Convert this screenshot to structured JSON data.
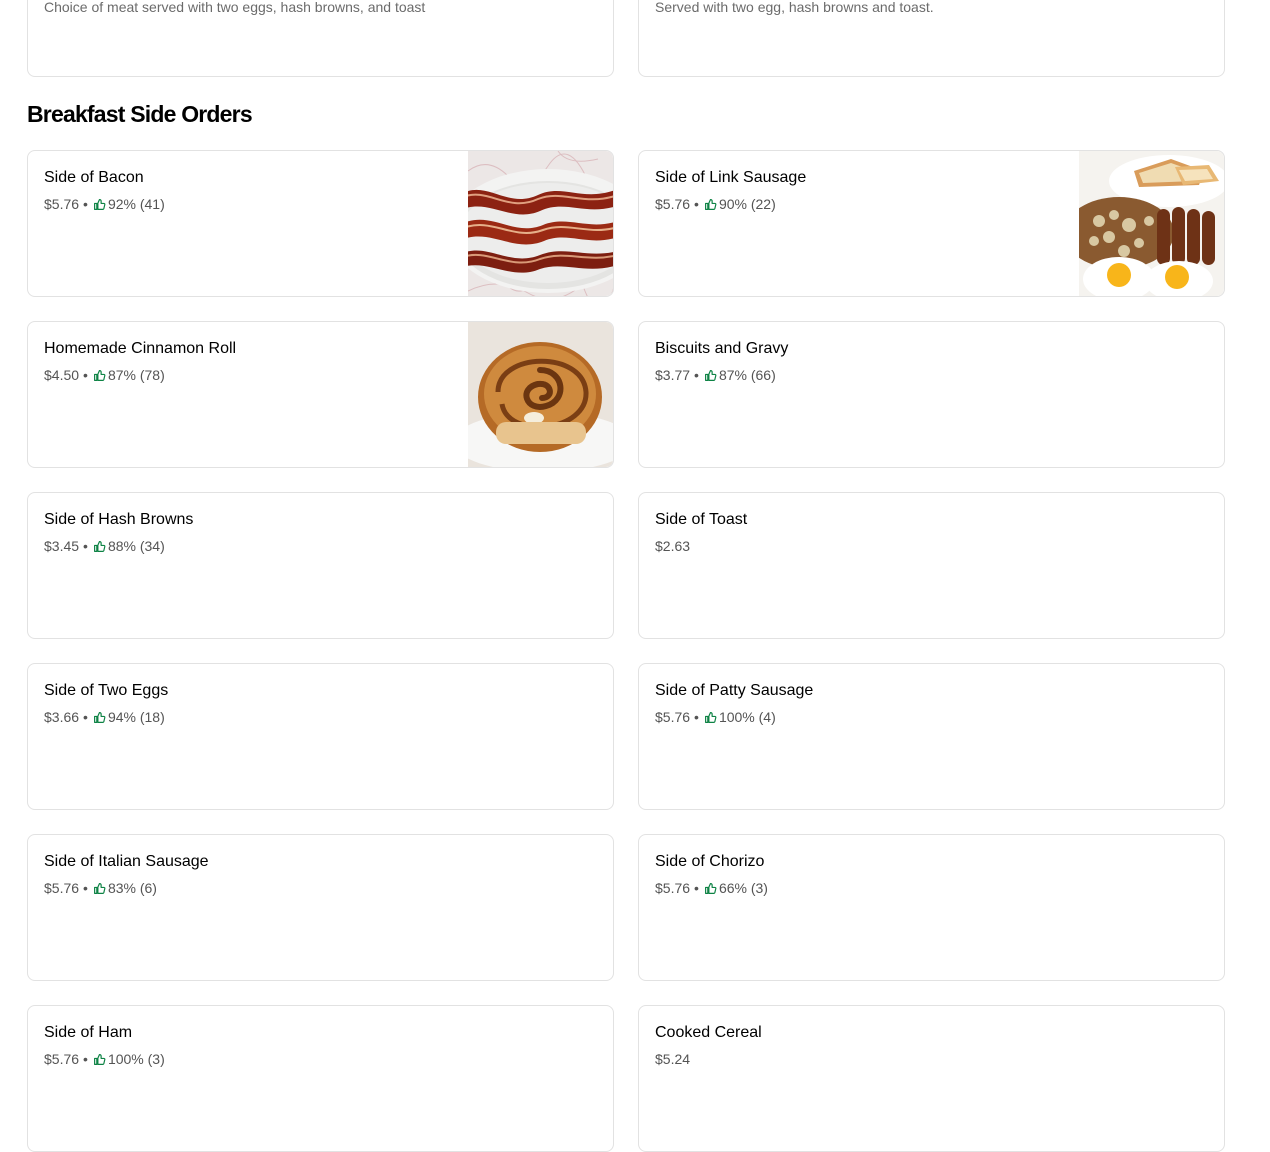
{
  "previous_row": [
    {
      "description": "Choice of meat served with two eggs, hash browns, and toast"
    },
    {
      "description": "Served with two egg, hash browns and toast."
    }
  ],
  "section": {
    "title": "Breakfast Side Orders"
  },
  "items": [
    {
      "name": "Side of Bacon",
      "price": "$5.76",
      "rating": "92% (41)",
      "image": "bacon-photo"
    },
    {
      "name": "Side of Link Sausage",
      "price": "$5.76",
      "rating": "90% (22)",
      "image": "link-sausage-photo"
    },
    {
      "name": "Homemade Cinnamon Roll",
      "price": "$4.50",
      "rating": "87% (78)",
      "image": "cinnamon-roll-photo"
    },
    {
      "name": "Biscuits and Gravy",
      "price": "$3.77",
      "rating": "87% (66)"
    },
    {
      "name": "Side of Hash Browns",
      "price": "$3.45",
      "rating": "88% (34)"
    },
    {
      "name": "Side of Toast",
      "price": "$2.63"
    },
    {
      "name": "Side of Two Eggs",
      "price": "$3.66",
      "rating": "94% (18)"
    },
    {
      "name": "Side of Patty Sausage",
      "price": "$5.76",
      "rating": "100% (4)"
    },
    {
      "name": "Side of Italian Sausage",
      "price": "$5.76",
      "rating": "83% (6)"
    },
    {
      "name": "Side of Chorizo",
      "price": "$5.76",
      "rating": "66% (3)"
    },
    {
      "name": "Side of Ham",
      "price": "$5.76",
      "rating": "100% (3)"
    },
    {
      "name": "Cooked Cereal",
      "price": "$5.24"
    }
  ],
  "colors": {
    "thumb_icon": "#0e8345",
    "border": "#e2e2e2",
    "secondary_text": "#545454"
  },
  "icons": {
    "rating": "thumbs-up-icon",
    "separator": "•"
  }
}
